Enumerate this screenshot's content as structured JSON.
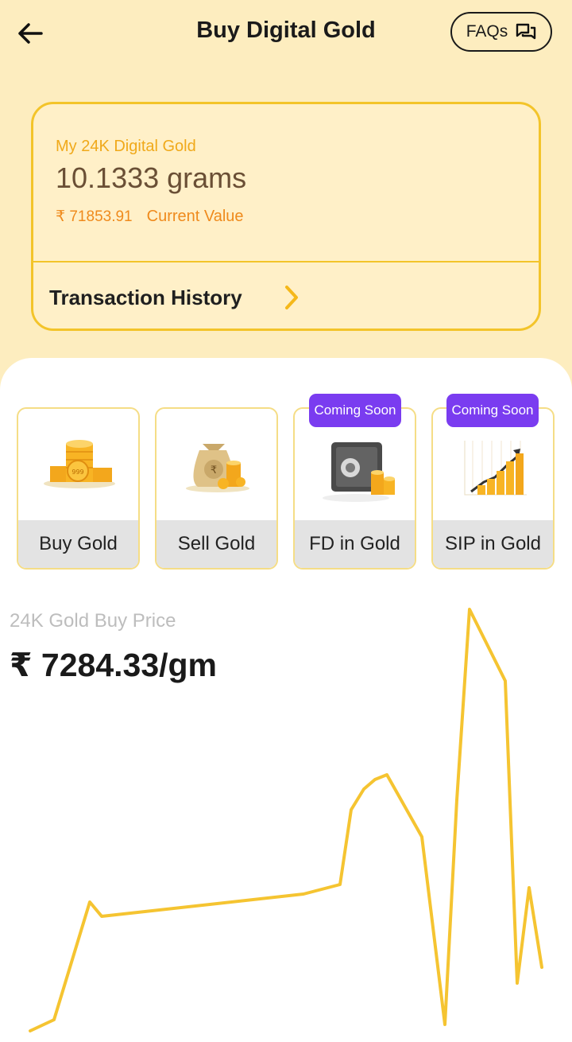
{
  "header": {
    "title": "Buy Digital Gold",
    "faq_label": "FAQs"
  },
  "holdings": {
    "label": "My 24K Digital Gold",
    "grams": "10.1333 grams",
    "value_amount": "₹ 71853.91",
    "value_label": "Current Value",
    "history_label": "Transaction History"
  },
  "actions": [
    {
      "label": "Buy Gold",
      "badge": ""
    },
    {
      "label": "Sell Gold",
      "badge": ""
    },
    {
      "label": "FD in Gold",
      "badge": "Coming Soon"
    },
    {
      "label": "SIP in Gold",
      "badge": "Coming Soon"
    }
  ],
  "price": {
    "label": "24K Gold Buy Price",
    "value": "₹ 7284.33/gm"
  },
  "colors": {
    "background": "#fdedbf",
    "accent": "#f3c42a",
    "badge": "#7a3cf0",
    "line": "#f5c431"
  },
  "chart_data": {
    "type": "line",
    "series": [
      {
        "values": [
          0.0,
          0.07,
          0.81,
          0.72,
          0.86,
          0.92,
          1.39,
          1.52,
          1.58,
          1.61,
          1.22,
          0.04,
          1.45,
          2.65,
          2.2,
          0.3,
          0.9,
          0.4
        ]
      }
    ]
  }
}
